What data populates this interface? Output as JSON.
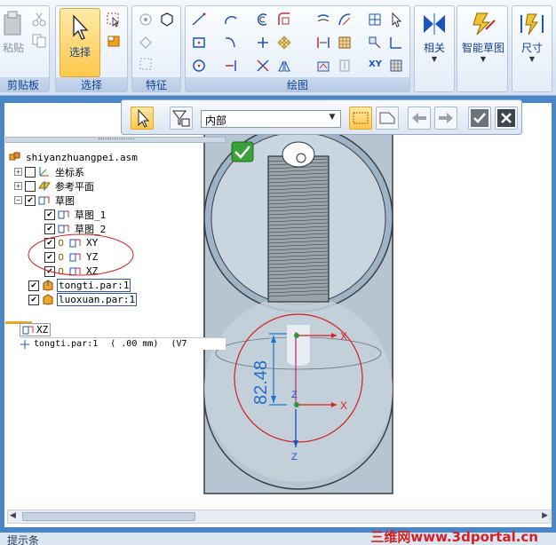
{
  "ribbon": {
    "clipboard": {
      "paste_label": "粘贴",
      "group_label": "剪贴板"
    },
    "select": {
      "select_label": "选择",
      "group_label": "选择"
    },
    "feature": {
      "group_label": "特征"
    },
    "draw": {
      "group_label": "绘图",
      "xy_label": "XY"
    },
    "relate": {
      "label": "相关"
    },
    "smart_sketch": {
      "label": "智能草图"
    },
    "dimension": {
      "label": "尺寸"
    }
  },
  "command_bar": {
    "dropdown_value": "内部"
  },
  "tree": {
    "root": "shiyanzhuangpei.asm",
    "items": [
      {
        "label": "坐标系"
      },
      {
        "label": "参考平面"
      },
      {
        "label": "草图"
      },
      {
        "label": "草图_1"
      },
      {
        "label": "草图_2"
      },
      {
        "label": "XY"
      },
      {
        "label": "YZ"
      },
      {
        "label": "XZ"
      },
      {
        "label": "tongti.par:1"
      },
      {
        "label": "luoxuan.par:1"
      }
    ]
  },
  "info": {
    "plane": "XZ",
    "part": "tongti.par:1",
    "value": "( .00 mm)",
    "suffix": "(V7"
  },
  "viewport": {
    "dimension_value": "82.48",
    "axis_z1": "Z",
    "axis_z2": "Z",
    "axis_x1": "X",
    "axis_x2": "X"
  },
  "status": {
    "text": "提示条"
  },
  "watermark": "三维网www.3dportal.cn",
  "colors": {
    "accent": "#ffc84b",
    "workspace": "#4a86c5",
    "dimension": "#1e6fd0",
    "circle": "#d31f1f"
  }
}
